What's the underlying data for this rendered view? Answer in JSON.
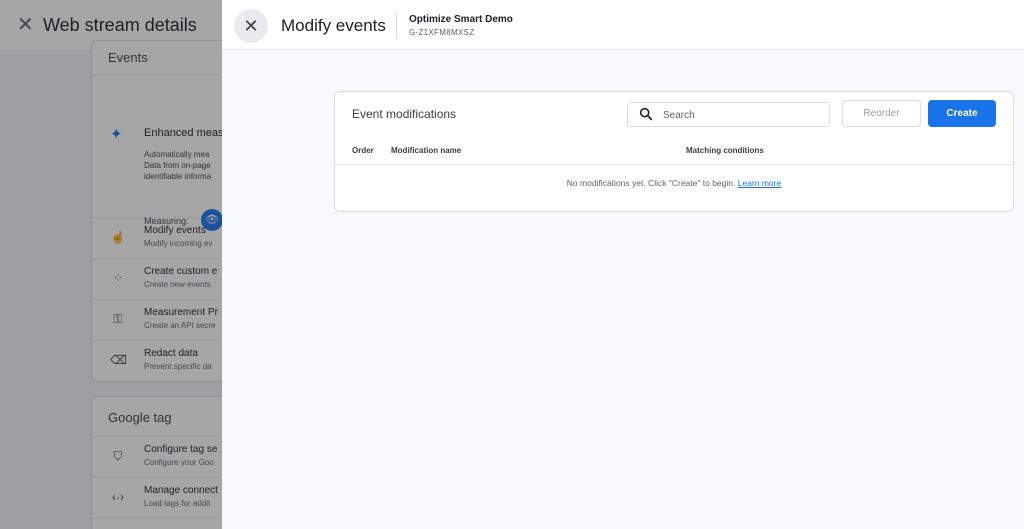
{
  "background": {
    "title": "Web stream details",
    "events_section": {
      "heading": "Events",
      "enhanced": {
        "title": "Enhanced measu",
        "description": [
          "Automatically mea",
          "Data from on-page",
          "identifiable informa"
        ],
        "measuring_label": "Measuring:"
      },
      "rows": [
        {
          "title": "Modify events",
          "subtitle": "Modify incoming ev",
          "icon": "touch-icon"
        },
        {
          "title": "Create custom e",
          "subtitle": "Create new events",
          "icon": "sparkle-cursor-icon"
        },
        {
          "title": "Measurement Pr",
          "subtitle": "Create an API secre",
          "icon": "key-icon"
        },
        {
          "title": "Redact data",
          "subtitle": "Prevent specific da",
          "icon": "eraser-icon"
        }
      ]
    },
    "gtag_section": {
      "heading": "Google tag",
      "rows": [
        {
          "title": "Configure tag se",
          "subtitle": "Configure your Goo",
          "icon": "tag-icon"
        },
        {
          "title": "Manage connect",
          "subtitle": "Load tags for addit",
          "icon": "code-arrows-icon"
        }
      ]
    }
  },
  "panel": {
    "title": "Modify events",
    "property_name": "Optimize Smart Demo",
    "property_id": "G-Z1XFM8MXSZ"
  },
  "card": {
    "title": "Event modifications",
    "search_placeholder": "Search",
    "reorder_label": "Reorder",
    "create_label": "Create",
    "columns": {
      "order": "Order",
      "name": "Modification name",
      "conditions": "Matching conditions"
    },
    "empty_text": "No modifications yet. Click \"Create\" to begin.",
    "learn_more": "Learn more"
  },
  "colors": {
    "accent": "#1a73e8",
    "overlay": "#5f6368",
    "panel_bg": "#f8f9fa"
  }
}
